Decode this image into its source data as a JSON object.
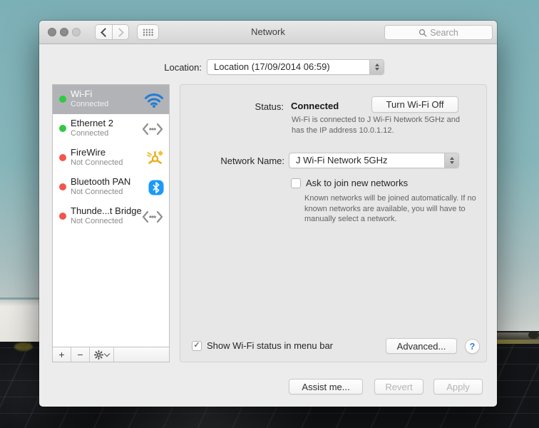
{
  "titlebar": {
    "title": "Network",
    "search_placeholder": "Search"
  },
  "location": {
    "label": "Location:",
    "value": "Location (17/09/2014 06:59)"
  },
  "sidebar": {
    "items": [
      {
        "name": "Wi-Fi",
        "status": "Connected",
        "state": "connected",
        "icon": "wifi",
        "selected": true
      },
      {
        "name": "Ethernet 2",
        "status": "Connected",
        "state": "connected",
        "icon": "bridge",
        "selected": false
      },
      {
        "name": "FireWire",
        "status": "Not Connected",
        "state": "disconnected",
        "icon": "firewire",
        "selected": false
      },
      {
        "name": "Bluetooth PAN",
        "status": "Not Connected",
        "state": "disconnected",
        "icon": "bluetooth",
        "selected": false
      },
      {
        "name": "Thunde...t Bridge",
        "status": "Not Connected",
        "state": "disconnected",
        "icon": "bridge",
        "selected": false
      }
    ],
    "add_label": "+",
    "remove_label": "−"
  },
  "panel": {
    "status_label": "Status:",
    "status_value": "Connected",
    "turn_off_button": "Turn Wi-Fi Off",
    "status_description": "Wi-Fi is connected to J Wi-Fi Network 5GHz and has the IP address 10.0.1.12.",
    "network_name_label": "Network Name:",
    "network_name_value": "J Wi-Fi Network 5GHz",
    "ask_join_label": "Ask to join new networks",
    "ask_join_checked": false,
    "ask_join_description": "Known networks will be joined automatically. If no known networks are available, you will have to manually select a network.",
    "menu_bar_label": "Show Wi-Fi status in menu bar",
    "menu_bar_checked": true,
    "advanced_button": "Advanced...",
    "help_button": "?"
  },
  "footer": {
    "assist_button": "Assist me...",
    "revert_button": "Revert",
    "apply_button": "Apply"
  },
  "colors": {
    "wifi_blue": "#1f7cd6",
    "bluetooth_blue": "#1b9af7",
    "connected_green": "#31c844",
    "disconnected_red": "#f4554e",
    "firewire_yellow": "#e8b020",
    "selected_row_gray": "#b1b3b6"
  }
}
